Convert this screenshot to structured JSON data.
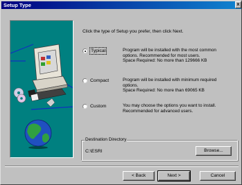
{
  "window": {
    "title": "Setup Type",
    "close_glyph": "x"
  },
  "art": {
    "description_icons": [
      "computer-icon",
      "disk-icon",
      "cd-icon",
      "globe-icon"
    ]
  },
  "instruction": "Click the type of Setup you prefer, then click Next.",
  "options": [
    {
      "label": "Typical",
      "selected": true,
      "desc": [
        "Program will be installed with the most common",
        "options. Recommended for most users.",
        "Space Required: No more than 129666 KB"
      ]
    },
    {
      "label": "Compact",
      "selected": false,
      "desc": [
        "Program will be installed with minimum required",
        "options.",
        "Space Required: No more than 69065 KB"
      ]
    },
    {
      "label": "Custom",
      "selected": false,
      "desc": [
        "You may choose the options you want to install.",
        "Recommended for advanced users."
      ]
    }
  ],
  "destination": {
    "legend": "Destination Directory",
    "path": "C:\\ESRI",
    "browse_label": "Browse..."
  },
  "buttons": {
    "back": "< Back",
    "next": "Next >",
    "cancel": "Cancel"
  },
  "colors": {
    "title_gradient_start": "#000080",
    "title_gradient_end": "#1084d0",
    "panel_bg": "#008080",
    "face": "#c0c0c0"
  }
}
